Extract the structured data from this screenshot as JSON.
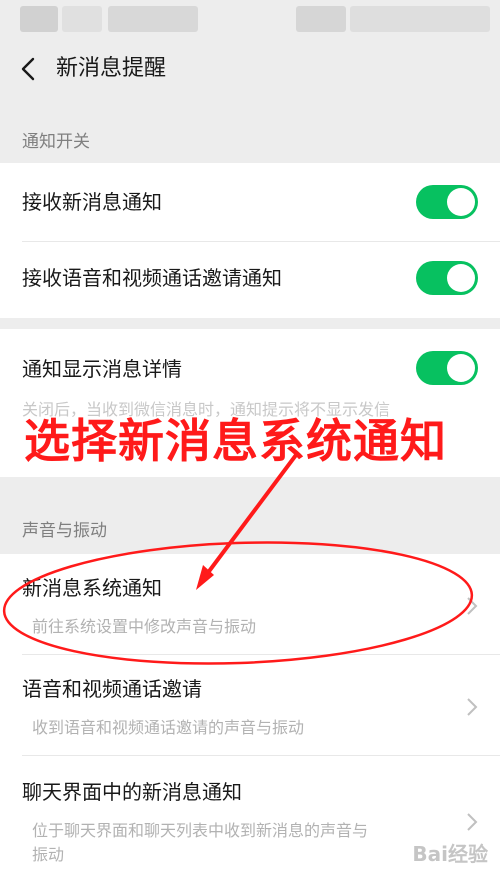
{
  "header": {
    "title": "新消息提醒"
  },
  "sections": {
    "notify_switch": {
      "title": "通知开关",
      "rows": [
        {
          "label": "接收新消息通知",
          "enabled": true
        },
        {
          "label": "接收语音和视频通话邀请通知",
          "enabled": true
        }
      ]
    },
    "detail": {
      "label": "通知显示消息详情",
      "enabled": true,
      "description": "关闭后，当收到微信消息时，通知提示将不显示发信"
    },
    "sound": {
      "title": "声音与振动",
      "rows": [
        {
          "label": "新消息系统通知",
          "sub": "前往系统设置中修改声音与振动"
        },
        {
          "label": "语音和视频通话邀请",
          "sub": "收到语音和视频通话邀请的声音与振动"
        },
        {
          "label": "聊天界面中的新消息通知",
          "sub": "位于聊天界面和聊天列表中收到新消息的声音与",
          "sub2": "振动"
        }
      ]
    }
  },
  "annotation": {
    "text": "选择新消息系统通知",
    "color": "#ff1a1a"
  },
  "watermark": {
    "text": "Bai经验"
  },
  "colors": {
    "switch_on": "#07c160",
    "background": "#ededed"
  }
}
